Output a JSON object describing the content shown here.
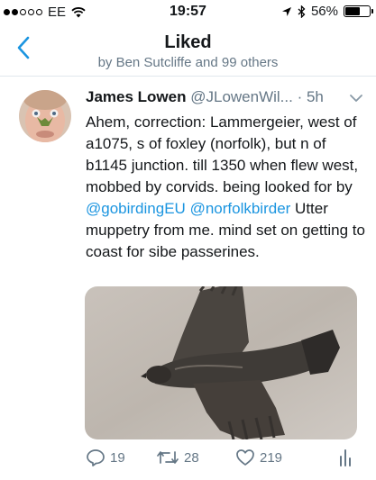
{
  "status_bar": {
    "carrier": "EE",
    "time": "19:57",
    "battery": "56%",
    "battery_level": 0.56,
    "signal_bars": 2
  },
  "header": {
    "title": "Liked",
    "subtitle": "by Ben Sutcliffe and 99 others",
    "back_icon": "chevron-left-icon"
  },
  "tweet": {
    "name": "James Lowen",
    "handle": "@JLowenWil...",
    "separator": " · ",
    "time": "5h",
    "text_before": "Ahem, correction: Lammergeier, west of a1075, s of foxley (norfolk), but n of b1145 junction. till 1350 when flew west, mobbed by corvids. being looked for by ",
    "mention1": "@gobirdingEU",
    "text_mid": " ",
    "mention2": "@norfolkbirder",
    "text_after": " Utter muppetry from me. mind set on getting to coast for sibe passerines.",
    "media_alt": "bird in flight photo",
    "counts": {
      "replies": "19",
      "retweets": "28",
      "likes": "219"
    }
  },
  "colors": {
    "accent": "#1b95e0",
    "muted": "#657786",
    "text": "#14171a",
    "divider": "#e1e8ed"
  }
}
